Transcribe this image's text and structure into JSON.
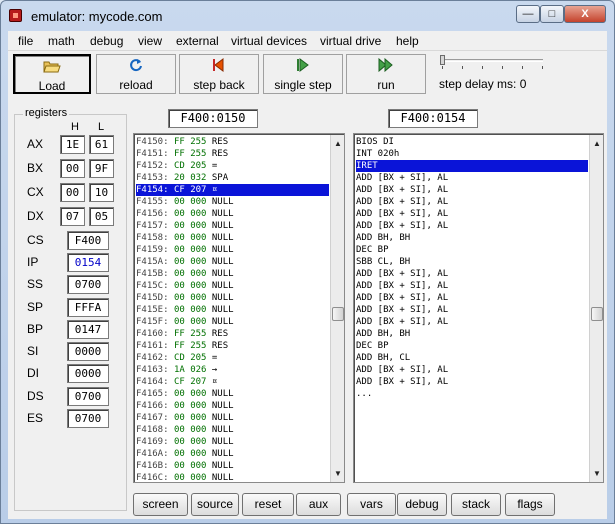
{
  "window": {
    "title": "emulator: mycode.com",
    "min": "—",
    "max": "□",
    "close": "X"
  },
  "menu": [
    "file",
    "math",
    "debug",
    "view",
    "external",
    "virtual devices",
    "virtual drive",
    "help"
  ],
  "toolbar": {
    "load": "Load",
    "reload": "reload",
    "step_back": "step back",
    "single_step": "single step",
    "run": "run",
    "step_delay": "step delay ms: 0"
  },
  "registers": {
    "title": "registers",
    "h": "H",
    "l": "L",
    "pairs": [
      {
        "name": "AX",
        "h": "1E",
        "l": "61"
      },
      {
        "name": "BX",
        "h": "00",
        "l": "9F"
      },
      {
        "name": "CX",
        "h": "00",
        "l": "10"
      },
      {
        "name": "DX",
        "h": "07",
        "l": "05"
      }
    ],
    "singles": [
      {
        "name": "CS",
        "value": "F400"
      },
      {
        "name": "IP",
        "value": "0154"
      },
      {
        "name": "SS",
        "value": "0700"
      },
      {
        "name": "SP",
        "value": "FFFA"
      },
      {
        "name": "BP",
        "value": "0147"
      },
      {
        "name": "SI",
        "value": "0000"
      },
      {
        "name": "DI",
        "value": "0000"
      },
      {
        "name": "DS",
        "value": "0700"
      },
      {
        "name": "ES",
        "value": "0700"
      }
    ]
  },
  "memory": {
    "address": "F400:0150",
    "selected_index": 4,
    "rows": [
      {
        "addr": "F4150:",
        "hex": "FF",
        "dec": "255",
        "ch": "RES"
      },
      {
        "addr": "F4151:",
        "hex": "FF",
        "dec": "255",
        "ch": "RES"
      },
      {
        "addr": "F4152:",
        "hex": "CD",
        "dec": "205",
        "ch": "="
      },
      {
        "addr": "F4153:",
        "hex": "20",
        "dec": "032",
        "ch": "SPA"
      },
      {
        "addr": "F4154:",
        "hex": "CF",
        "dec": "207",
        "ch": "¤"
      },
      {
        "addr": "F4155:",
        "hex": "00",
        "dec": "000",
        "ch": "NULL"
      },
      {
        "addr": "F4156:",
        "hex": "00",
        "dec": "000",
        "ch": "NULL"
      },
      {
        "addr": "F4157:",
        "hex": "00",
        "dec": "000",
        "ch": "NULL"
      },
      {
        "addr": "F4158:",
        "hex": "00",
        "dec": "000",
        "ch": "NULL"
      },
      {
        "addr": "F4159:",
        "hex": "00",
        "dec": "000",
        "ch": "NULL"
      },
      {
        "addr": "F415A:",
        "hex": "00",
        "dec": "000",
        "ch": "NULL"
      },
      {
        "addr": "F415B:",
        "hex": "00",
        "dec": "000",
        "ch": "NULL"
      },
      {
        "addr": "F415C:",
        "hex": "00",
        "dec": "000",
        "ch": "NULL"
      },
      {
        "addr": "F415D:",
        "hex": "00",
        "dec": "000",
        "ch": "NULL"
      },
      {
        "addr": "F415E:",
        "hex": "00",
        "dec": "000",
        "ch": "NULL"
      },
      {
        "addr": "F415F:",
        "hex": "00",
        "dec": "000",
        "ch": "NULL"
      },
      {
        "addr": "F4160:",
        "hex": "FF",
        "dec": "255",
        "ch": "RES"
      },
      {
        "addr": "F4161:",
        "hex": "FF",
        "dec": "255",
        "ch": "RES"
      },
      {
        "addr": "F4162:",
        "hex": "CD",
        "dec": "205",
        "ch": "="
      },
      {
        "addr": "F4163:",
        "hex": "1A",
        "dec": "026",
        "ch": "→"
      },
      {
        "addr": "F4164:",
        "hex": "CF",
        "dec": "207",
        "ch": "¤"
      },
      {
        "addr": "F4165:",
        "hex": "00",
        "dec": "000",
        "ch": "NULL"
      },
      {
        "addr": "F4166:",
        "hex": "00",
        "dec": "000",
        "ch": "NULL"
      },
      {
        "addr": "F4167:",
        "hex": "00",
        "dec": "000",
        "ch": "NULL"
      },
      {
        "addr": "F4168:",
        "hex": "00",
        "dec": "000",
        "ch": "NULL"
      },
      {
        "addr": "F4169:",
        "hex": "00",
        "dec": "000",
        "ch": "NULL"
      },
      {
        "addr": "F416A:",
        "hex": "00",
        "dec": "000",
        "ch": "NULL"
      },
      {
        "addr": "F416B:",
        "hex": "00",
        "dec": "000",
        "ch": "NULL"
      },
      {
        "addr": "F416C:",
        "hex": "00",
        "dec": "000",
        "ch": "NULL"
      }
    ]
  },
  "disassembly": {
    "address": "F400:0154",
    "selected_index": 2,
    "rows": [
      "BIOS DI",
      "INT 020h",
      "IRET",
      "ADD [BX + SI], AL",
      "ADD [BX + SI], AL",
      "ADD [BX + SI], AL",
      "ADD [BX + SI], AL",
      "ADD [BX + SI], AL",
      "ADD BH, BH",
      "DEC BP",
      "SBB CL, BH",
      "ADD [BX + SI], AL",
      "ADD [BX + SI], AL",
      "ADD [BX + SI], AL",
      "ADD [BX + SI], AL",
      "ADD [BX + SI], AL",
      "ADD BH, BH",
      "DEC BP",
      "ADD BH, CL",
      "ADD [BX + SI], AL",
      "ADD [BX + SI], AL",
      "..."
    ]
  },
  "bottom_buttons": [
    "screen",
    "source",
    "reset",
    "aux",
    "vars",
    "debug",
    "stack",
    "flags"
  ],
  "colors": {
    "selection": "#0a14d8",
    "reg_highlight": "#0000c8",
    "memory_hex": "#007000"
  }
}
